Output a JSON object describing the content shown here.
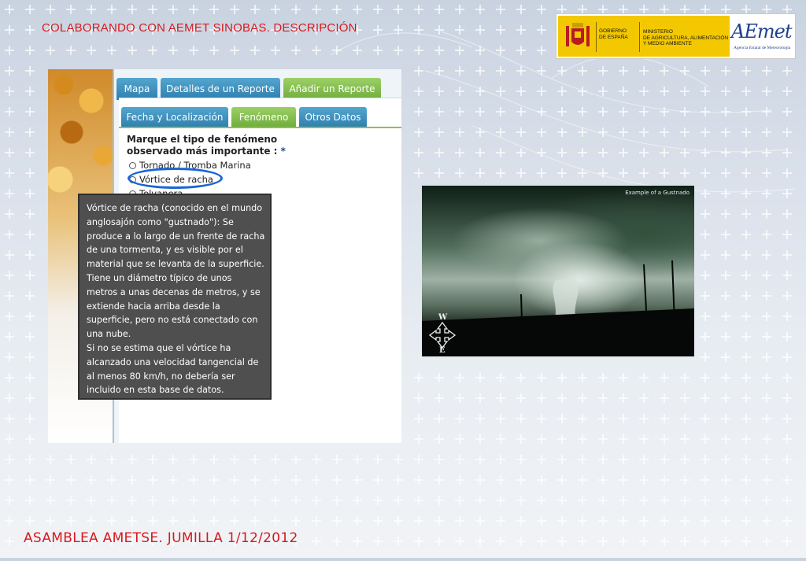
{
  "header": {
    "title": "COLABORANDO CON AEMET SINOBAS. DESCRIPCIÓN"
  },
  "logos": {
    "gobierno": "GOBIERNO\nDE ESPAÑA",
    "ministerio": "MINISTERIO\nDE AGRICULTURA, ALIMENTACIÓN\nY MEDIO AMBIENTE",
    "aemet": "AEmet",
    "aemet_sub": "Agencia Estatal de Meteorología"
  },
  "app": {
    "main_tabs": [
      "Mapa",
      "Detalles de un Reporte",
      "Añadir un Reporte"
    ],
    "sub_tabs": [
      "Fecha y Localización",
      "Fenómeno",
      "Otros Datos"
    ],
    "prompt_line1": "Marque el tipo de fenómeno",
    "prompt_line2": "observado más importante :",
    "required_mark": "*",
    "options": [
      "Tornado / Tromba Marina",
      "Vórtice de racha",
      "Tolvanera"
    ]
  },
  "tooltip": {
    "paragraph1": "Vórtice de racha (conocido en el mundo anglosajón como \"gustnado\"): Se produce a lo largo de un frente de racha de una tormenta, y es visible por el material que se levanta de la superficie. Tiene un diámetro típico de unos metros a unas decenas de metros, y se extiende hacia arriba desde la superficie, pero no está conectado con una nube.",
    "paragraph2": "Si no se estima que el vórtice ha alcanzado una velocidad tangencial de al menos 80 km/h, no debería ser incluido en esta base de datos."
  },
  "photo": {
    "caption": "Example of a Gustnado",
    "compass_top": "W",
    "compass_bottom": "E"
  },
  "footer": {
    "title": "ASAMBLEA AMETSE. JUMILLA 1/12/2012"
  },
  "colors": {
    "accent_red": "#d7191c",
    "tab_blue": "#2e7fae",
    "tab_green": "#6fad3a",
    "tooltip_bg": "#4f4f4f"
  }
}
